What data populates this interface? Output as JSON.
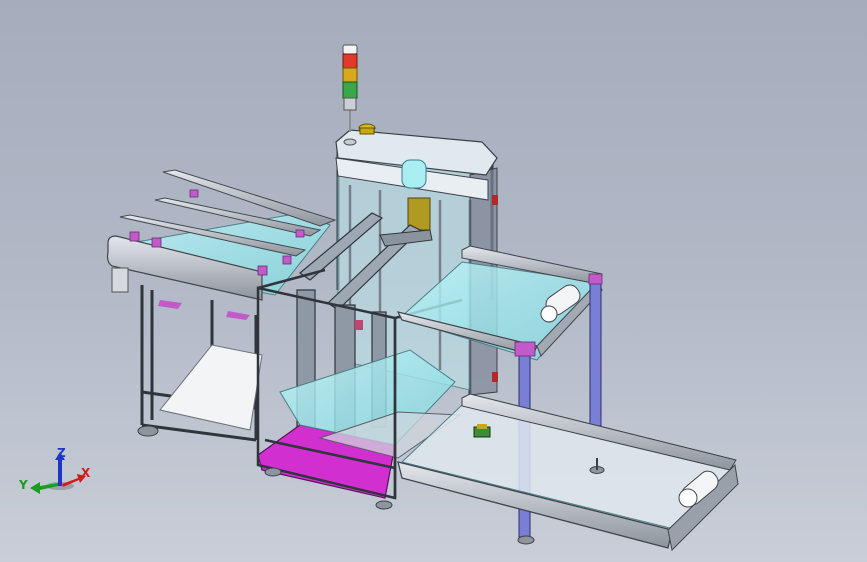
{
  "view": {
    "background_top": "#a5adbd",
    "background_bottom": "#c9ced8"
  },
  "triad": {
    "x_label": "X",
    "y_label": "Y",
    "z_label": "Z",
    "x_color": "#d11c1c",
    "y_color": "#169e1c",
    "z_color": "#1f34c9"
  },
  "palette": {
    "glass": "#9fe6ec",
    "frame": "#3b4249",
    "rail": "#c3c7ce",
    "magenta_panel": "#d12fd0",
    "post_blue": "#7a7fd6",
    "light_red": "#e23a2a",
    "light_amber": "#d9a91c",
    "light_green": "#3aa84a"
  },
  "icons": [
    "stack-light-icon",
    "emergency-stop-icon",
    "caster-foot-icon",
    "coordinate-triad-icon"
  ]
}
